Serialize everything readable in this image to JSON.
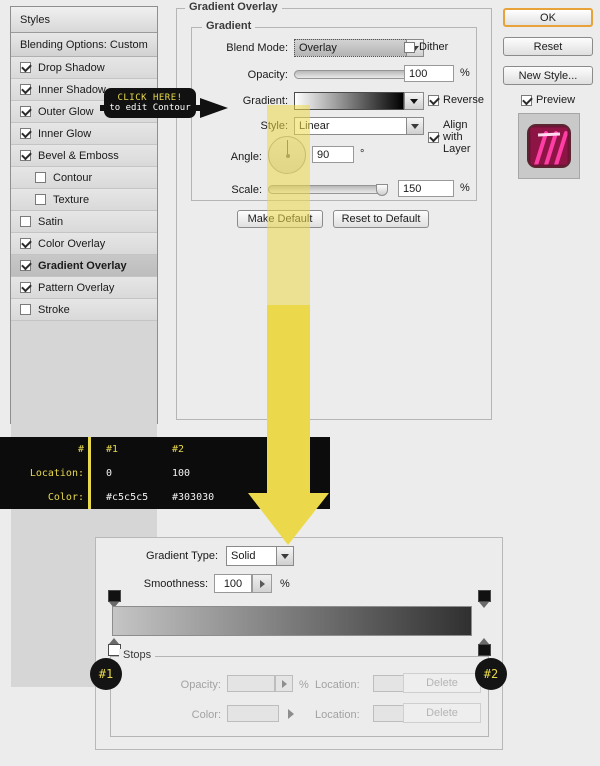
{
  "styles_panel": {
    "header": "Styles",
    "blending_options": "Blending Options: Custom",
    "items": [
      {
        "label": "Drop Shadow",
        "checked": true,
        "indent": false,
        "selected": false
      },
      {
        "label": "Inner Shadow",
        "checked": true,
        "indent": false,
        "selected": false
      },
      {
        "label": "Outer Glow",
        "checked": true,
        "indent": false,
        "selected": false
      },
      {
        "label": "Inner Glow",
        "checked": true,
        "indent": false,
        "selected": false
      },
      {
        "label": "Bevel & Emboss",
        "checked": true,
        "indent": false,
        "selected": false
      },
      {
        "label": "Contour",
        "checked": false,
        "indent": true,
        "selected": false
      },
      {
        "label": "Texture",
        "checked": false,
        "indent": true,
        "selected": false
      },
      {
        "label": "Satin",
        "checked": false,
        "indent": false,
        "selected": false
      },
      {
        "label": "Color Overlay",
        "checked": true,
        "indent": false,
        "selected": false
      },
      {
        "label": "Gradient Overlay",
        "checked": true,
        "indent": false,
        "selected": true
      },
      {
        "label": "Pattern Overlay",
        "checked": true,
        "indent": false,
        "selected": false
      },
      {
        "label": "Stroke",
        "checked": false,
        "indent": false,
        "selected": false
      }
    ]
  },
  "gradient_overlay": {
    "group_title": "Gradient Overlay",
    "sub_group_title": "Gradient",
    "blend_mode": {
      "label": "Blend Mode:",
      "value": "Overlay"
    },
    "opacity": {
      "label": "Opacity:",
      "value": "100",
      "unit": "%"
    },
    "gradient": {
      "label": "Gradient:",
      "from": "#ffffff",
      "to": "#000000"
    },
    "style": {
      "label": "Style:",
      "value": "Linear"
    },
    "angle": {
      "label": "Angle:",
      "value": "90",
      "unit": "°"
    },
    "scale": {
      "label": "Scale:",
      "value": "150",
      "unit": "%"
    },
    "dither": {
      "label": "Dither",
      "checked": false
    },
    "reverse": {
      "label": "Reverse",
      "checked": true
    },
    "align_with_layer": {
      "label": "Align with Layer",
      "checked": true
    },
    "make_default": "Make Default",
    "reset_to_default": "Reset to Default"
  },
  "actions": {
    "ok": "OK",
    "reset": "Reset",
    "new_style": "New Style...",
    "preview": {
      "label": "Preview",
      "checked": true
    }
  },
  "data_table": {
    "rows": [
      {
        "key": "#",
        "c1": "#1",
        "c2": "#2"
      },
      {
        "key": "Location:",
        "c1": "0",
        "c2": "100"
      },
      {
        "key": "Color:",
        "c1": "#c5c5c5",
        "c2": "#303030"
      }
    ],
    "key_color": "#e8d94b",
    "value_color": "#f2f2f2",
    "background": "#0c0c0c"
  },
  "gradient_editor": {
    "gradient_type": {
      "label": "Gradient Type:",
      "value": "Solid"
    },
    "smoothness": {
      "label": "Smoothness:",
      "value": "100",
      "unit": "%"
    },
    "stops_group_title": "Stops",
    "opacity": {
      "label": "Opacity:",
      "value": "",
      "unit": "%"
    },
    "opacity_location": {
      "label": "Location:",
      "value": "",
      "unit": "%"
    },
    "opacity_delete": "Delete",
    "color": {
      "label": "Color:",
      "value": ""
    },
    "color_location": {
      "label": "Location:",
      "value": "",
      "unit": "%"
    },
    "color_delete": "Delete",
    "bar": {
      "from": "#c5c5c5",
      "to": "#303030"
    },
    "badges": [
      "#1",
      "#2"
    ]
  },
  "callout": {
    "line1": "CLICK HERE!",
    "line2": "to edit Contour",
    "text_color": "#e8d94b",
    "background": "#111111"
  },
  "annotation": {
    "arrow_color": "#ecd94b"
  }
}
